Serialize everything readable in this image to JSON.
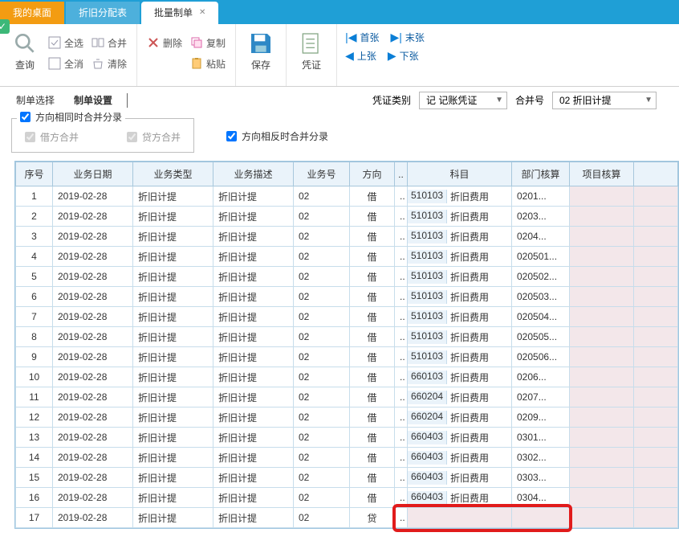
{
  "tabs": {
    "desktop": "我的桌面",
    "alloc": "折旧分配表",
    "batch": "批量制单"
  },
  "toolbar": {
    "query": "查询",
    "select_all": "全选",
    "deselect_all": "全消",
    "merge": "合并",
    "clear": "清除",
    "delete": "删除",
    "copy": "复制",
    "paste": "粘贴",
    "save": "保存",
    "voucher": "凭证",
    "first": "首张",
    "last": "末张",
    "prev": "上张",
    "next": "下张"
  },
  "subtabs": {
    "select": "制单选择",
    "setting": "制单设置"
  },
  "filters": {
    "voucher_type_label": "凭证类别",
    "voucher_type_value": "记 记账凭证",
    "merge_no_label": "合并号",
    "merge_no_value": "02 折旧计提"
  },
  "options": {
    "same_dir_merge": "方向相同时合并分录",
    "debit_merge": "借方合并",
    "credit_merge": "贷方合并",
    "opp_dir_merge": "方向相反时合并分录"
  },
  "columns": {
    "seq": "序号",
    "date": "业务日期",
    "type": "业务类型",
    "desc": "业务描述",
    "no": "业务号",
    "dir": "方向",
    "subject": "科目",
    "dept": "部门核算",
    "proj": "项目核算"
  },
  "rows": [
    {
      "seq": "1",
      "date": "2019-02-28",
      "type": "折旧计提",
      "desc": "折旧计提",
      "no": "02",
      "dir": "借",
      "scode": "510103",
      "sname": "折旧费用",
      "dept": "0201..."
    },
    {
      "seq": "2",
      "date": "2019-02-28",
      "type": "折旧计提",
      "desc": "折旧计提",
      "no": "02",
      "dir": "借",
      "scode": "510103",
      "sname": "折旧费用",
      "dept": "0203..."
    },
    {
      "seq": "3",
      "date": "2019-02-28",
      "type": "折旧计提",
      "desc": "折旧计提",
      "no": "02",
      "dir": "借",
      "scode": "510103",
      "sname": "折旧费用",
      "dept": "0204..."
    },
    {
      "seq": "4",
      "date": "2019-02-28",
      "type": "折旧计提",
      "desc": "折旧计提",
      "no": "02",
      "dir": "借",
      "scode": "510103",
      "sname": "折旧费用",
      "dept": "020501..."
    },
    {
      "seq": "5",
      "date": "2019-02-28",
      "type": "折旧计提",
      "desc": "折旧计提",
      "no": "02",
      "dir": "借",
      "scode": "510103",
      "sname": "折旧费用",
      "dept": "020502..."
    },
    {
      "seq": "6",
      "date": "2019-02-28",
      "type": "折旧计提",
      "desc": "折旧计提",
      "no": "02",
      "dir": "借",
      "scode": "510103",
      "sname": "折旧费用",
      "dept": "020503..."
    },
    {
      "seq": "7",
      "date": "2019-02-28",
      "type": "折旧计提",
      "desc": "折旧计提",
      "no": "02",
      "dir": "借",
      "scode": "510103",
      "sname": "折旧费用",
      "dept": "020504..."
    },
    {
      "seq": "8",
      "date": "2019-02-28",
      "type": "折旧计提",
      "desc": "折旧计提",
      "no": "02",
      "dir": "借",
      "scode": "510103",
      "sname": "折旧费用",
      "dept": "020505..."
    },
    {
      "seq": "9",
      "date": "2019-02-28",
      "type": "折旧计提",
      "desc": "折旧计提",
      "no": "02",
      "dir": "借",
      "scode": "510103",
      "sname": "折旧费用",
      "dept": "020506..."
    },
    {
      "seq": "10",
      "date": "2019-02-28",
      "type": "折旧计提",
      "desc": "折旧计提",
      "no": "02",
      "dir": "借",
      "scode": "660103",
      "sname": "折旧费用",
      "dept": "0206..."
    },
    {
      "seq": "11",
      "date": "2019-02-28",
      "type": "折旧计提",
      "desc": "折旧计提",
      "no": "02",
      "dir": "借",
      "scode": "660204",
      "sname": "折旧费用",
      "dept": "0207..."
    },
    {
      "seq": "12",
      "date": "2019-02-28",
      "type": "折旧计提",
      "desc": "折旧计提",
      "no": "02",
      "dir": "借",
      "scode": "660204",
      "sname": "折旧费用",
      "dept": "0209..."
    },
    {
      "seq": "13",
      "date": "2019-02-28",
      "type": "折旧计提",
      "desc": "折旧计提",
      "no": "02",
      "dir": "借",
      "scode": "660403",
      "sname": "折旧费用",
      "dept": "0301..."
    },
    {
      "seq": "14",
      "date": "2019-02-28",
      "type": "折旧计提",
      "desc": "折旧计提",
      "no": "02",
      "dir": "借",
      "scode": "660403",
      "sname": "折旧费用",
      "dept": "0302..."
    },
    {
      "seq": "15",
      "date": "2019-02-28",
      "type": "折旧计提",
      "desc": "折旧计提",
      "no": "02",
      "dir": "借",
      "scode": "660403",
      "sname": "折旧费用",
      "dept": "0303..."
    },
    {
      "seq": "16",
      "date": "2019-02-28",
      "type": "折旧计提",
      "desc": "折旧计提",
      "no": "02",
      "dir": "借",
      "scode": "660403",
      "sname": "折旧费用",
      "dept": "0304..."
    },
    {
      "seq": "17",
      "date": "2019-02-28",
      "type": "折旧计提",
      "desc": "折旧计提",
      "no": "02",
      "dir": "贷",
      "scode": "",
      "sname": "",
      "dept": ""
    }
  ]
}
